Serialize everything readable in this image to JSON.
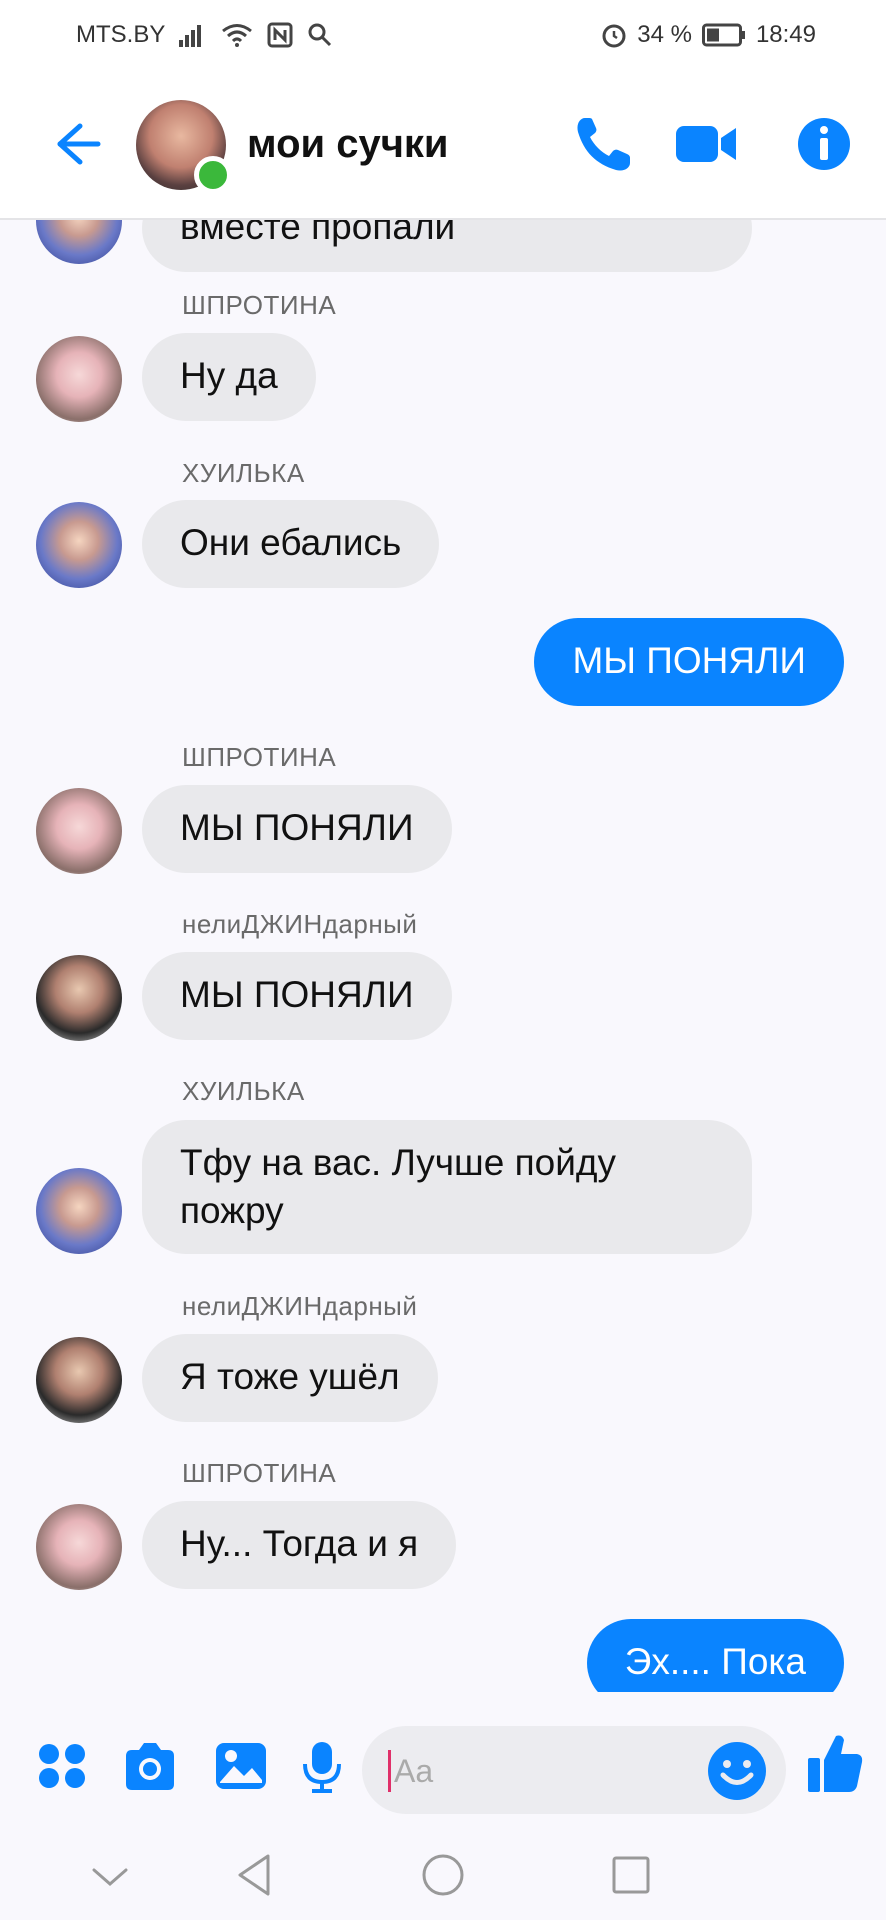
{
  "status": {
    "carrier": "MTS.BY",
    "battery": "34 %",
    "time": "18:49"
  },
  "header": {
    "title": "мои сучки"
  },
  "messages": [
    {
      "id": "partial",
      "text": "вместе пропали",
      "mine": false
    },
    {
      "sender": "ШПРОТИНА",
      "text": "Ну да",
      "mine": false
    },
    {
      "sender": "ХУИЛЬКА",
      "text": "Они ебались",
      "mine": false
    },
    {
      "text": "МЫ ПОНЯЛИ",
      "mine": true
    },
    {
      "sender": "ШПРОТИНА",
      "text": "МЫ ПОНЯЛИ",
      "mine": false
    },
    {
      "sender": "нелиДЖИНдарный",
      "text": "МЫ ПОНЯЛИ",
      "mine": false
    },
    {
      "sender": "ХУИЛЬКА",
      "text": "Тфу на вас. Лучше пойду пожру",
      "mine": false
    },
    {
      "sender": "нелиДЖИНдарный",
      "text": "Я тоже ушёл",
      "mine": false
    },
    {
      "sender": "ШПРОТИНА",
      "text": "Ну... Тогда и я",
      "mine": false
    },
    {
      "text": "Эх.... Пока",
      "mine": true
    }
  ],
  "composer": {
    "placeholder": "Aa"
  },
  "colors": {
    "accent": "#0a84ff",
    "incoming_bubble": "#e9e9ec",
    "online": "#3bb83b"
  },
  "icons": {
    "header": [
      "back-arrow-icon",
      "phone-icon",
      "video-camera-icon",
      "info-icon"
    ],
    "composer": [
      "apps-grid-icon",
      "camera-icon",
      "gallery-icon",
      "microphone-icon",
      "emoji-icon",
      "thumbs-up-icon"
    ],
    "navbar": [
      "chevron-down-icon",
      "back-triangle-icon",
      "home-circle-icon",
      "recents-square-icon"
    ]
  }
}
